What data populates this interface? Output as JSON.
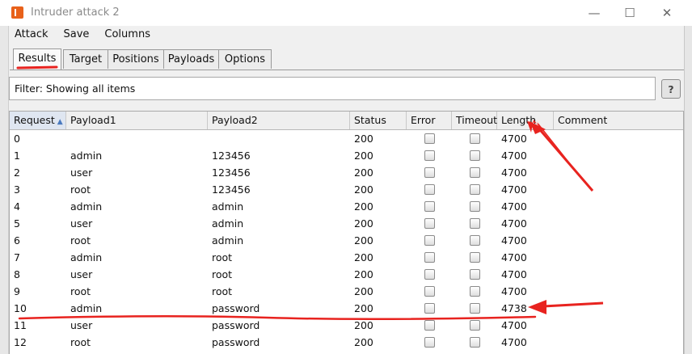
{
  "window": {
    "title": "Intruder attack 2",
    "minimize_glyph": "—",
    "maximize_glyph": "☐",
    "close_glyph": "✕"
  },
  "menu": [
    "Attack",
    "Save",
    "Columns"
  ],
  "tabs": [
    "Results",
    "Target",
    "Positions",
    "Payloads",
    "Options"
  ],
  "filter": {
    "text": "Filter: Showing all items",
    "help_glyph": "?"
  },
  "table": {
    "columns": [
      "Request",
      "Payload1",
      "Payload2",
      "Status",
      "Error",
      "Timeout",
      "Length",
      "Comment"
    ],
    "sort_glyph": "▲",
    "rows": [
      {
        "request": "0",
        "payload1": "",
        "payload2": "",
        "status": "200",
        "error": false,
        "timeout": false,
        "length": "4700",
        "comment": ""
      },
      {
        "request": "1",
        "payload1": "admin",
        "payload2": "123456",
        "status": "200",
        "error": false,
        "timeout": false,
        "length": "4700",
        "comment": ""
      },
      {
        "request": "2",
        "payload1": "user",
        "payload2": "123456",
        "status": "200",
        "error": false,
        "timeout": false,
        "length": "4700",
        "comment": ""
      },
      {
        "request": "3",
        "payload1": "root",
        "payload2": "123456",
        "status": "200",
        "error": false,
        "timeout": false,
        "length": "4700",
        "comment": ""
      },
      {
        "request": "4",
        "payload1": "admin",
        "payload2": "admin",
        "status": "200",
        "error": false,
        "timeout": false,
        "length": "4700",
        "comment": ""
      },
      {
        "request": "5",
        "payload1": "user",
        "payload2": "admin",
        "status": "200",
        "error": false,
        "timeout": false,
        "length": "4700",
        "comment": ""
      },
      {
        "request": "6",
        "payload1": "root",
        "payload2": "admin",
        "status": "200",
        "error": false,
        "timeout": false,
        "length": "4700",
        "comment": ""
      },
      {
        "request": "7",
        "payload1": "admin",
        "payload2": "root",
        "status": "200",
        "error": false,
        "timeout": false,
        "length": "4700",
        "comment": ""
      },
      {
        "request": "8",
        "payload1": "user",
        "payload2": "root",
        "status": "200",
        "error": false,
        "timeout": false,
        "length": "4700",
        "comment": ""
      },
      {
        "request": "9",
        "payload1": "root",
        "payload2": "root",
        "status": "200",
        "error": false,
        "timeout": false,
        "length": "4700",
        "comment": ""
      },
      {
        "request": "10",
        "payload1": "admin",
        "payload2": "password",
        "status": "200",
        "error": false,
        "timeout": false,
        "length": "4738",
        "comment": ""
      },
      {
        "request": "11",
        "payload1": "user",
        "payload2": "password",
        "status": "200",
        "error": false,
        "timeout": false,
        "length": "4700",
        "comment": ""
      },
      {
        "request": "12",
        "payload1": "root",
        "payload2": "password",
        "status": "200",
        "error": false,
        "timeout": false,
        "length": "4700",
        "comment": ""
      }
    ]
  },
  "annotation_color": "#e8231f",
  "icons": [
    "burp-app-icon",
    "help-icon",
    "sort-ascending-icon",
    "checkbox-icon"
  ]
}
